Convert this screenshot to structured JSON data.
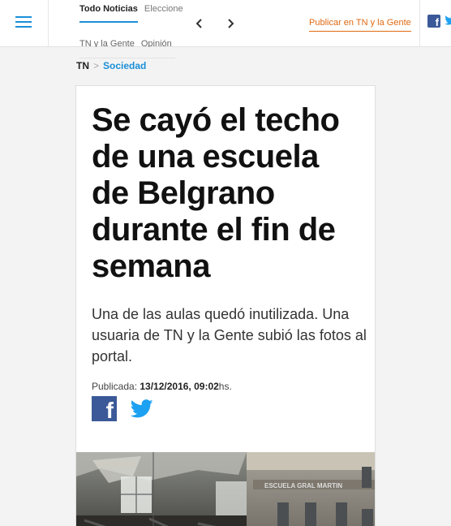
{
  "nav": {
    "row1": [
      "Todo Noticias",
      "Elecciones"
    ],
    "row2": [
      "TN y la Gente",
      "Opinión"
    ]
  },
  "header": {
    "publish_label": "Publicar en TN y la Gente",
    "facebook_letter": "f"
  },
  "breadcrumb": {
    "home": "TN",
    "separator": ">",
    "section": "Sociedad"
  },
  "article": {
    "title": "Se cayó el techo de una escuela de Belgrano durante el fin de semana",
    "lead": "Una de las aulas quedó inutilizada. Una usuaria de TN y la Gente subió las fotos al portal.",
    "published_label": "Publicada: ",
    "published_date": "13/12/2016, 09:02",
    "published_suffix": "hs.",
    "share_facebook_letter": "f",
    "photo_sign_text": "ESCUELA GRAL MARTIN"
  },
  "colors": {
    "accent": "#1a8fd8",
    "publish": "#e06a13",
    "facebook": "#3b5998",
    "twitter": "#1da1f2"
  }
}
